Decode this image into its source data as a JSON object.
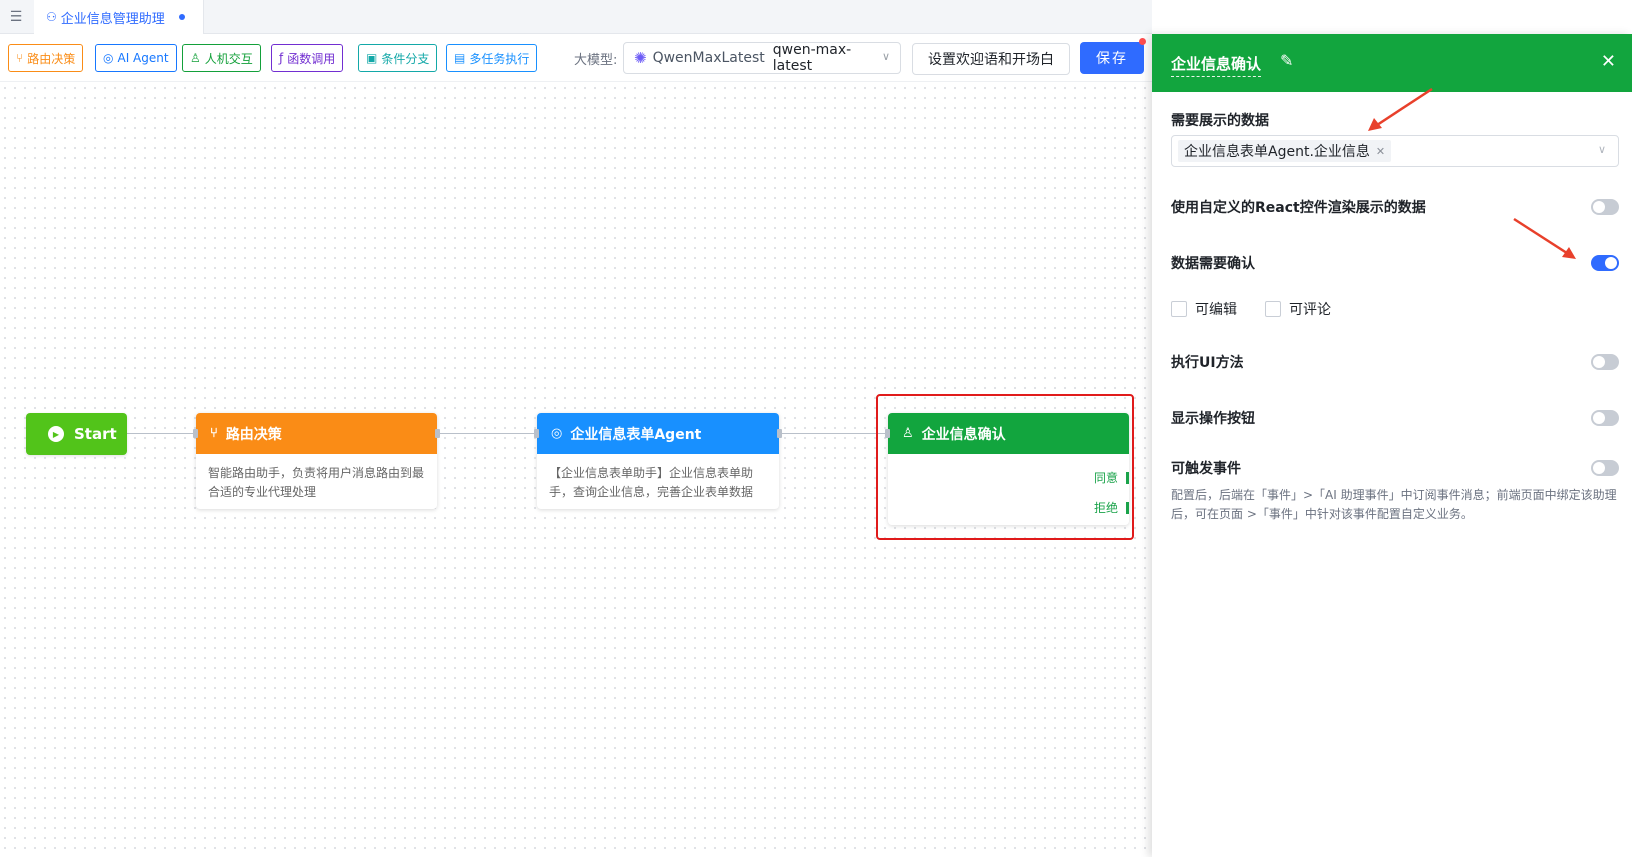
{
  "tabbar": {
    "collapse_icon": "menu-fold-icon",
    "tab_icon": "robot-icon",
    "tab_label": "企业信息管理助理"
  },
  "toolbar": {
    "items": [
      {
        "label": "路由决策",
        "icon": "branch-icon",
        "color": "#fa8c16"
      },
      {
        "label": "AI Agent",
        "icon": "agent-icon",
        "color": "#1677ff"
      },
      {
        "label": "人机交互",
        "icon": "user-icon",
        "color": "#13a03a"
      },
      {
        "label": "函数调用",
        "icon": "function-icon",
        "color": "#722ed1"
      },
      {
        "label": "条件分支",
        "icon": "condition-icon",
        "color": "#13a8a8"
      },
      {
        "label": "多任务执行",
        "icon": "multitask-icon",
        "color": "#1890ff"
      }
    ],
    "model_label": "大模型:",
    "model_name": "QwenMaxLatest",
    "model_value": "qwen-max-latest",
    "welcome_button": "设置欢迎语和开场白",
    "save_button": "保存"
  },
  "canvas": {
    "start": {
      "label": "Start"
    },
    "router": {
      "title": "路由决策",
      "desc": "智能路由助手，负责将用户消息路由到最合适的专业代理处理",
      "color": "#fa8c16"
    },
    "agent": {
      "title": "企业信息表单Agent",
      "desc": "【企业信息表单助手】企业信息表单助手，查询企业信息，完善企业表单数据",
      "color": "#1890ff"
    },
    "confirm": {
      "title": "企业信息确认",
      "color": "#12a53e",
      "out_agree": "同意",
      "out_reject": "拒绝"
    }
  },
  "panel": {
    "title": "企业信息确认",
    "data_label": "需要展示的数据",
    "data_tag": "企业信息表单Agent.企业信息",
    "react_label": "使用自定义的React控件渲染展示的数据",
    "react_on": false,
    "confirm_label": "数据需要确认",
    "confirm_on": true,
    "editable_label": "可编辑",
    "commentable_label": "可评论",
    "ui_method_label": "执行UI方法",
    "ui_method_on": false,
    "show_buttons_label": "显示操作按钮",
    "show_buttons_on": false,
    "event_label": "可触发事件",
    "event_on": false,
    "event_hint": "配置后，后端在「事件」>「AI 助理事件」中订阅事件消息；前端页面中绑定该助理后，可在页面 >「事件」中针对该事件配置自定义业务。"
  }
}
